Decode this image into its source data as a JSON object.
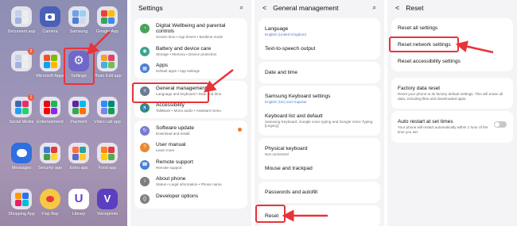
{
  "colors": {
    "accent_red": "#e8333a",
    "link_blue": "#4a7fd6"
  },
  "home": {
    "apps": [
      {
        "label": "Document aup",
        "icon": "folder-icon",
        "badge": ""
      },
      {
        "label": "Camera",
        "icon": "camera-icon",
        "badge": ""
      },
      {
        "label": "Samsung",
        "icon": "samsung-folder-icon",
        "badge": ""
      },
      {
        "label": "Google App",
        "icon": "google-folder-icon",
        "badge": ""
      },
      {
        "label": "",
        "icon": "folder-icon",
        "badge": "2"
      },
      {
        "label": "Microsoft Apps",
        "icon": "microsoft-folder-icon",
        "badge": ""
      },
      {
        "label": "Settings",
        "icon": "gear-icon",
        "badge": ""
      },
      {
        "label": "Photo Edit app",
        "icon": "photo-folder-icon",
        "badge": ""
      },
      {
        "label": "Social Media",
        "icon": "social-folder-icon",
        "badge": "1"
      },
      {
        "label": "Entertainment",
        "icon": "entertainment-folder-icon",
        "badge": ""
      },
      {
        "label": "Payment",
        "icon": "payment-folder-icon",
        "badge": ""
      },
      {
        "label": "Video call app",
        "icon": "video-folder-icon",
        "badge": ""
      },
      {
        "label": "Messages",
        "icon": "messages-icon",
        "badge": ""
      },
      {
        "label": "Security app",
        "icon": "security-folder-icon",
        "badge": ""
      },
      {
        "label": "Extra app",
        "icon": "extra-folder-icon",
        "badge": ""
      },
      {
        "label": "Food app",
        "icon": "food-folder-icon",
        "badge": ""
      },
      {
        "label": "Shopping App",
        "icon": "shopping-folder-icon",
        "badge": ""
      },
      {
        "label": "Flap Bay",
        "icon": "flappy-bird-icon",
        "badge": ""
      },
      {
        "label": "Library",
        "icon": "library-icon",
        "badge": ""
      },
      {
        "label": "Voiceprints",
        "icon": "voiceprints-icon",
        "badge": ""
      }
    ]
  },
  "settings": {
    "title": "Settings",
    "items": [
      {
        "title": "Digital Wellbeing and parental controls",
        "sub": "Screen time • App timers • Bedtime mode",
        "icon": "wellbeing-icon",
        "color": "#48a35b"
      },
      {
        "title": "Battery and device care",
        "sub": "Storage • Memory • Device protection",
        "icon": "battery-care-icon",
        "color": "#3aa58f"
      },
      {
        "title": "Apps",
        "sub": "Default apps • App settings",
        "icon": "apps-grid-icon",
        "color": "#4a7fd6"
      },
      {
        "title": "General management",
        "sub": "Language and keyboard • Date and time",
        "icon": "sliders-icon",
        "color": "#6a7a92"
      },
      {
        "title": "Accessibility",
        "sub": "TalkBack • Mono audio • Assistant menu",
        "icon": "accessibility-icon",
        "color": "#2f9a55"
      },
      {
        "title": "Software update",
        "sub": "Download and install",
        "icon": "software-update-icon",
        "color": "#7a7ad2"
      },
      {
        "title": "User manual",
        "sub": "Learn more",
        "icon": "manual-icon",
        "color": "#e88a33"
      },
      {
        "title": "Remote support",
        "sub": "Remote support",
        "icon": "remote-support-icon",
        "color": "#4a7fd6"
      },
      {
        "title": "About phone",
        "sub": "Status • Legal information • Phone name",
        "icon": "info-icon",
        "color": "#7f7f7f"
      },
      {
        "title": "Developer options",
        "sub": "",
        "icon": "developer-icon",
        "color": "#7f7f7f"
      }
    ]
  },
  "general": {
    "title": "General management",
    "language_title": "Language",
    "language_sub": "English (United Kingdom)",
    "tts": "Text-to-speech output",
    "datetime": "Date and time",
    "skb_title": "Samsung Keyboard settings",
    "skb_sub": "English (UK) and Gujarati",
    "kld_title": "Keyboard list and default",
    "kld_sub": "Samsung Keyboard, Google voice typing and Google Voice Typing [Legacy]",
    "pk_title": "Physical keyboard",
    "pk_sub": "Not connected",
    "mouse": "Mouse and trackpad",
    "passwords": "Passwords and autofill",
    "reset": "Reset"
  },
  "reset": {
    "title": "Reset",
    "all": "Reset all settings",
    "network": "Reset network settings",
    "accessibility": "Reset accessibility settings",
    "factory_title": "Factory data reset",
    "factory_sub": "Reset your phone to its factory default settings. This will erase all data, including files and downloaded apps.",
    "auto_title": "Auto restart at set times",
    "auto_sub": "Your phone will restart automatically within 1 hour of the time you set."
  },
  "search_icon_glyph": "⌕",
  "back_glyph": "<"
}
